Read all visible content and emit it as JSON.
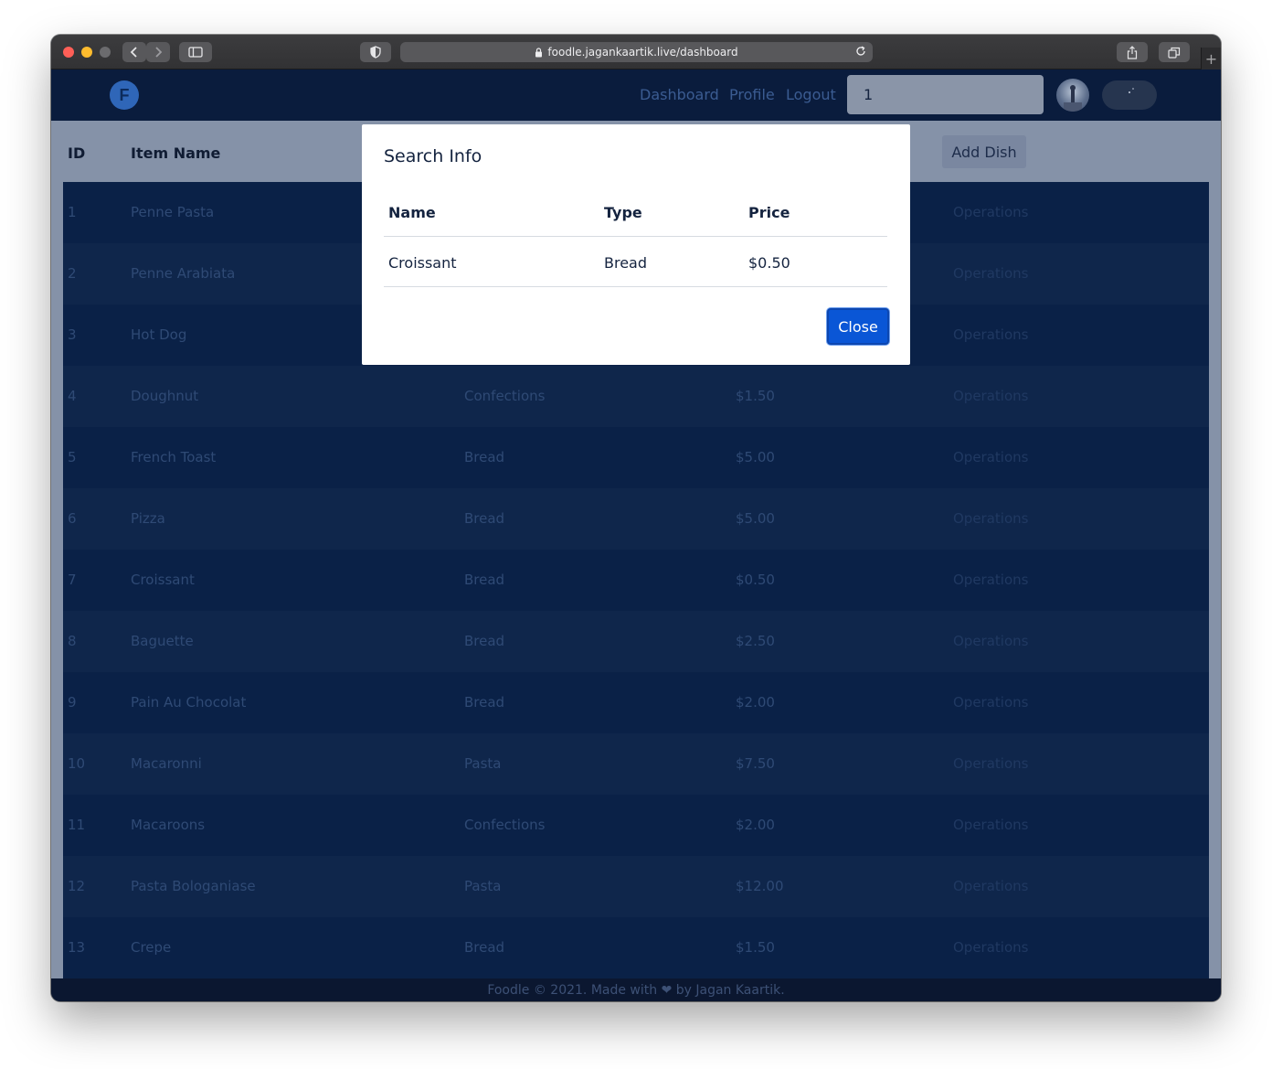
{
  "browser": {
    "url": "foodle.jagankaartik.live/dashboard"
  },
  "navbar": {
    "logo_letter": "F",
    "links": [
      "Dashboard",
      "Profile",
      "Logout"
    ],
    "search_value": "1"
  },
  "table": {
    "headers": {
      "id": "ID",
      "name": "Item Name"
    },
    "add_button": "Add Dish",
    "rows": [
      {
        "id": "1",
        "name": "Penne Pasta",
        "type": "",
        "price": "",
        "ops": "Operations"
      },
      {
        "id": "2",
        "name": "Penne Arabiata",
        "type": "",
        "price": "",
        "ops": "Operations"
      },
      {
        "id": "3",
        "name": "Hot Dog",
        "type": "",
        "price": "",
        "ops": "Operations"
      },
      {
        "id": "4",
        "name": "Doughnut",
        "type": "Confections",
        "price": "$1.50",
        "ops": "Operations"
      },
      {
        "id": "5",
        "name": "French Toast",
        "type": "Bread",
        "price": "$5.00",
        "ops": "Operations"
      },
      {
        "id": "6",
        "name": "Pizza",
        "type": "Bread",
        "price": "$5.00",
        "ops": "Operations"
      },
      {
        "id": "7",
        "name": "Croissant",
        "type": "Bread",
        "price": "$0.50",
        "ops": "Operations"
      },
      {
        "id": "8",
        "name": "Baguette",
        "type": "Bread",
        "price": "$2.50",
        "ops": "Operations"
      },
      {
        "id": "9",
        "name": "Pain Au Chocolat",
        "type": "Bread",
        "price": "$2.00",
        "ops": "Operations"
      },
      {
        "id": "10",
        "name": "Macaronni",
        "type": "Pasta",
        "price": "$7.50",
        "ops": "Operations"
      },
      {
        "id": "11",
        "name": "Macaroons",
        "type": "Confections",
        "price": "$2.00",
        "ops": "Operations"
      },
      {
        "id": "12",
        "name": "Pasta Bologaniase",
        "type": "Pasta",
        "price": "$12.00",
        "ops": "Operations"
      },
      {
        "id": "13",
        "name": "Crepe",
        "type": "Bread",
        "price": "$1.50",
        "ops": "Operations"
      }
    ]
  },
  "footer": {
    "text": "Foodle © 2021. Made with ❤ by Jagan Kaartik."
  },
  "modal": {
    "title": "Search Info",
    "headers": [
      "Name",
      "Type",
      "Price"
    ],
    "row": {
      "name": "Croissant",
      "type": "Bread",
      "price": "$0.50"
    },
    "close_label": "Close"
  },
  "colors": {
    "navbar": "#0a1c3d",
    "row_odd": "#0a2147",
    "row_even": "#0f264b",
    "overlay": "#8592a8",
    "primary_button": "#0a56d6"
  }
}
